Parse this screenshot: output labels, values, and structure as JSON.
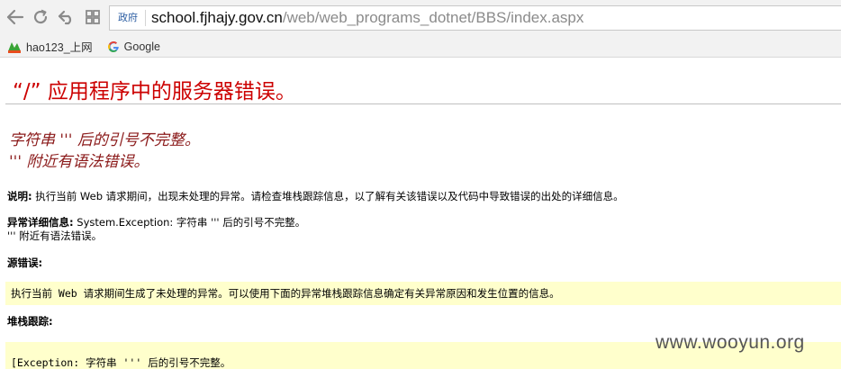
{
  "browser": {
    "gov_badge": "政府",
    "url_host": "school.fjhajy.gov.cn",
    "url_path": "/web/web_programs_dotnet/BBS/index.aspx",
    "bookmarks": [
      {
        "label": "hao123_上网",
        "icon": "hao123-icon"
      },
      {
        "label": "Google",
        "icon": "google-icon"
      }
    ]
  },
  "page": {
    "title": "“/” 应用程序中的服务器错误。",
    "error_line1": "字符串 ''' 后的引号不完整。",
    "error_line2": "''' 附近有语法错误。",
    "description_label": "说明:",
    "description_text": " 执行当前 Web 请求期间，出现未处理的异常。请检查堆栈跟踪信息，以了解有关该错误以及代码中导致错误的出处的详细信息。",
    "exception_label": "异常详细信息:",
    "exception_text": " System.Exception: 字符串 ''' 后的引号不完整。",
    "exception_text2": "''' 附近有语法错误。",
    "source_label": "源错误:",
    "source_text": "执行当前 Web 请求期间生成了未处理的异常。可以使用下面的异常堆栈跟踪信息确定有关异常原因和发生位置的信息。",
    "stack_label": "堆栈跟踪:",
    "stack_text": "[Exception: 字符串 ''' 后的引号不完整。"
  },
  "watermark": "www.wooyun.org"
}
